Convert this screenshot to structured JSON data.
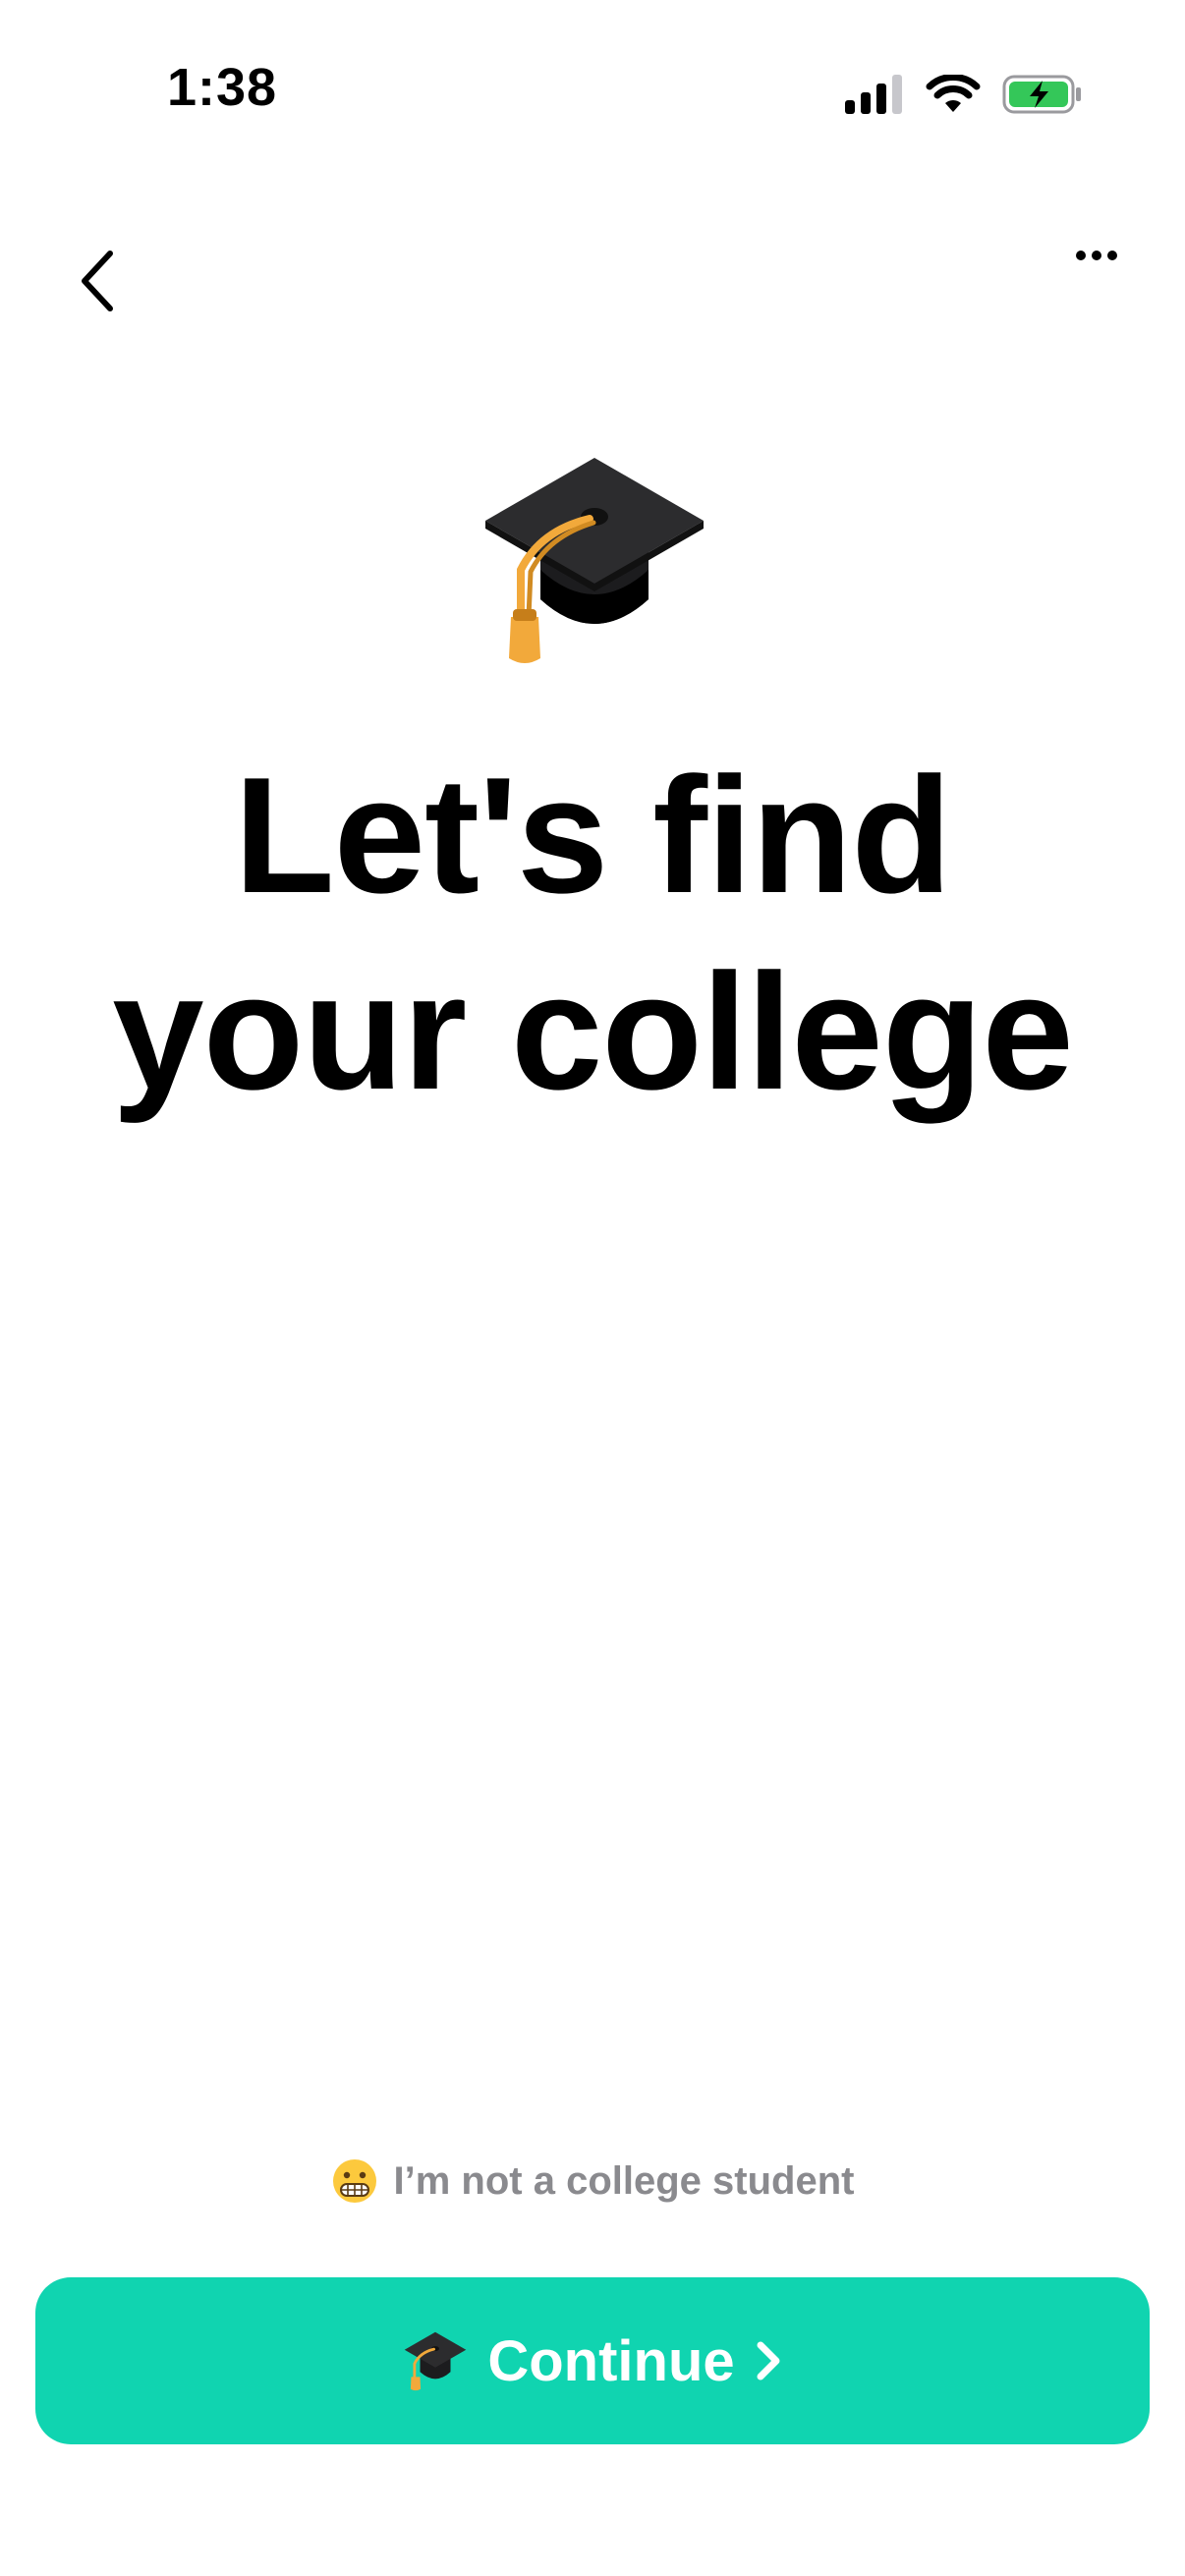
{
  "status_bar": {
    "time": "1:38",
    "icons": [
      "cellular-signal-icon",
      "wifi-icon",
      "battery-charging-icon"
    ],
    "battery_color": "#34c759"
  },
  "nav": {
    "back_icon": "chevron-left-icon",
    "more_icon": "ellipsis-icon"
  },
  "hero": {
    "icon": "graduation-cap-icon"
  },
  "title": {
    "line1": "Let's find",
    "line2": "your college"
  },
  "not_student": {
    "icon": "grimacing-face-icon",
    "label": "I’m not a college student"
  },
  "continue_button": {
    "icon": "graduation-cap-icon",
    "label": "Continue",
    "arrow_icon": "chevron-right-icon",
    "color": "#10d4b0"
  }
}
